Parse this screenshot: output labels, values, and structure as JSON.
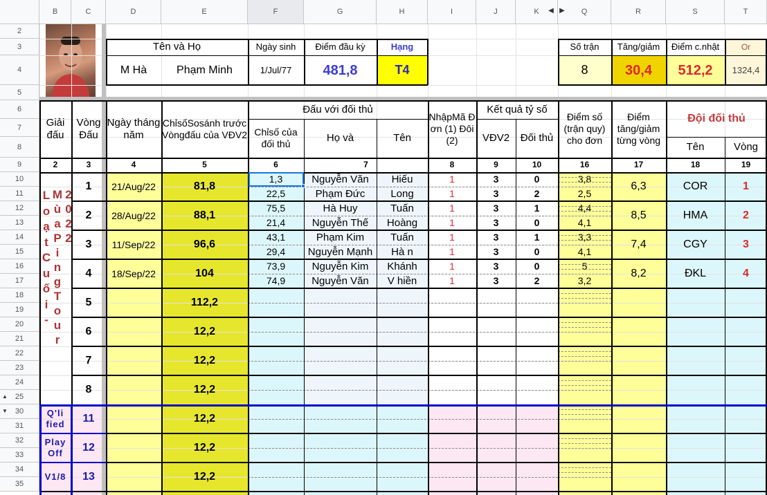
{
  "columns": [
    "B",
    "C",
    "D",
    "E",
    "F",
    "G",
    "H",
    "I",
    "J",
    "K",
    "Q",
    "R",
    "S",
    "T"
  ],
  "rows": [
    "2",
    "3",
    "4",
    "5",
    "6",
    "7",
    "8",
    "9",
    "10",
    "11",
    "12",
    "13",
    "14",
    "15",
    "16",
    "17",
    "18",
    "19",
    "20",
    "21",
    "22",
    "23",
    "24",
    "25",
    "30",
    "31",
    "32",
    "33",
    "34",
    "35"
  ],
  "profile": {
    "headers": {
      "name": "Tên    và    Họ",
      "dob": "Ngày sinh",
      "start_score": "Điểm đầu kỳ",
      "rank": "Hạng"
    },
    "given_name": "M Hà",
    "family_name": "Phạm Minh",
    "dob": "1/Jul/77",
    "start_score": "481,8",
    "rank": "T4"
  },
  "summary": {
    "headers": {
      "matches": "Số trận",
      "delta": "Tăng/giảm",
      "updated": "Điểm c.nhật",
      "or": "Or"
    },
    "matches": "8",
    "delta": "30,4",
    "updated": "512,2",
    "or": "1324,4"
  },
  "table_headers": {
    "tournament": "Giải đấu",
    "round": "Vòng Đấu",
    "date": "Ngày tháng năm",
    "index": "ChỉsốSosánh trướcVòngđấu của VĐV2",
    "vs": "Đấu với đối thủ",
    "opp_index": "Chỉsố của đối thủ",
    "opp_name": "Họ     và",
    "opp_given": "Tên",
    "code": "NhậpMã Đơn (1) Đôi (2)",
    "result": "Kết quả tỷ số",
    "vdv2": "VĐV2",
    "opp": "Đối thủ",
    "score": "Điểm số (trận quy) cho đơn",
    "change": "Điểm tăng/giảm từng vòng",
    "team": "Đội đối thủ",
    "team_name": "Tên",
    "team_round": "Vòng"
  },
  "col_numbers": [
    "2",
    "3",
    "4",
    "5",
    "6",
    "7",
    "8",
    "9",
    "10",
    "16",
    "17",
    "18",
    "19"
  ],
  "tournament_vertical": {
    "col1": "LoạtCuối-",
    "col2": "MùaPingTour",
    "col3": "2022"
  },
  "rounds": [
    {
      "round": "1",
      "date": "21/Aug/22",
      "index": "81,8",
      "change": "6,3",
      "team": "COR",
      "team_round": "1",
      "matches": [
        {
          "opp_index": "1,3",
          "opp_name": "Nguyễn Văn",
          "opp_given": "Hiếu",
          "code": "1",
          "vdv2": "3",
          "opp": "0",
          "score": "3,8"
        },
        {
          "opp_index": "22,5",
          "opp_name": "Phạm Đức",
          "opp_given": "Long",
          "code": "1",
          "vdv2": "3",
          "opp": "2",
          "score": "2,5"
        }
      ]
    },
    {
      "round": "2",
      "date": "28/Aug/22",
      "index": "88,1",
      "change": "8,5",
      "team": "HMA",
      "team_round": "2",
      "matches": [
        {
          "opp_index": "75,5",
          "opp_name": "Hà Huy",
          "opp_given": "Tuấn",
          "code": "1",
          "vdv2": "3",
          "opp": "1",
          "score": "4,4"
        },
        {
          "opp_index": "21,4",
          "opp_name": "Nguyễn Thế",
          "opp_given": "Hoàng",
          "code": "1",
          "vdv2": "3",
          "opp": "0",
          "score": "4,1"
        }
      ]
    },
    {
      "round": "3",
      "date": "11/Sep/22",
      "index": "96,6",
      "change": "7,4",
      "team": "CGY",
      "team_round": "3",
      "matches": [
        {
          "opp_index": "43,1",
          "opp_name": "Phạm Kim",
          "opp_given": "Tuấn",
          "code": "1",
          "vdv2": "3",
          "opp": "1",
          "score": "3,3"
        },
        {
          "opp_index": "29,4",
          "opp_name": "Nguyễn Mạnh",
          "opp_given": "Hà n",
          "code": "1",
          "vdv2": "3",
          "opp": "0",
          "score": "4,1"
        }
      ]
    },
    {
      "round": "4",
      "date": "18/Sep/22",
      "index": "104",
      "change": "8,2",
      "team": "ĐKL",
      "team_round": "4",
      "matches": [
        {
          "opp_index": "73,9",
          "opp_name": "Nguyễn Kim",
          "opp_given": "Khánh",
          "code": "1",
          "vdv2": "3",
          "opp": "0",
          "score": "5"
        },
        {
          "opp_index": "74,9",
          "opp_name": "Nguyễn Văn",
          "opp_given": "V hiền",
          "code": "1",
          "vdv2": "3",
          "opp": "2",
          "score": "3,2"
        }
      ]
    },
    {
      "round": "5",
      "index": "112,2"
    },
    {
      "round": "6",
      "index": "12,2"
    },
    {
      "round": "7",
      "index": "12,2"
    },
    {
      "round": "8",
      "index": "12,2"
    }
  ],
  "extra": [
    {
      "label": "Q'li fied",
      "round": "11",
      "index": "12,2"
    },
    {
      "label": "Play Off",
      "round": "12",
      "index": "12,2"
    },
    {
      "label": "V1/8",
      "round": "13",
      "index": "12,2"
    }
  ],
  "colors": {
    "yellow": "#ffff99",
    "olive": "#e6e62c",
    "rank_yellow": "#ffff00",
    "cyan": "#dcf7fb",
    "pink": "#fde7f3",
    "blue_text": "#3c3cd6",
    "red_text": "#e0282c",
    "dark_red": "#b03434",
    "navy": "#0000c8"
  },
  "icons": [
    "collapse-arrow-icon",
    "expand-arrow-icon"
  ]
}
